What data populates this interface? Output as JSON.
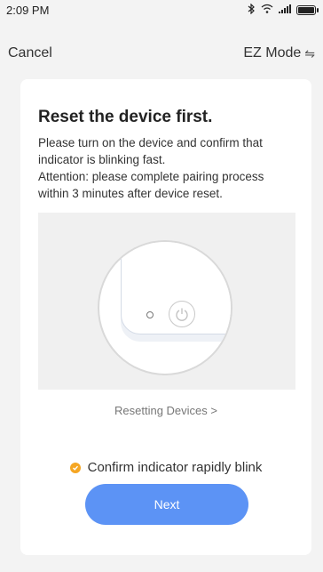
{
  "status_bar": {
    "time": "2:09 PM"
  },
  "nav": {
    "cancel_label": "Cancel",
    "mode_label": "EZ Mode",
    "mode_icon": "⇋"
  },
  "card": {
    "title": "Reset the device first.",
    "description": "Please turn on the device and confirm that indicator is blinking fast.",
    "attention": "Attention: please complete pairing process within 3 minutes after device reset.",
    "reset_link": "Resetting Devices >",
    "confirm_label": "Confirm indicator rapidly blink",
    "confirm_checked": true,
    "next_label": "Next"
  },
  "colors": {
    "accent": "#5c93f5",
    "check": "#f5a623",
    "card_bg": "#ffffff",
    "page_bg": "#f3f3f3"
  }
}
